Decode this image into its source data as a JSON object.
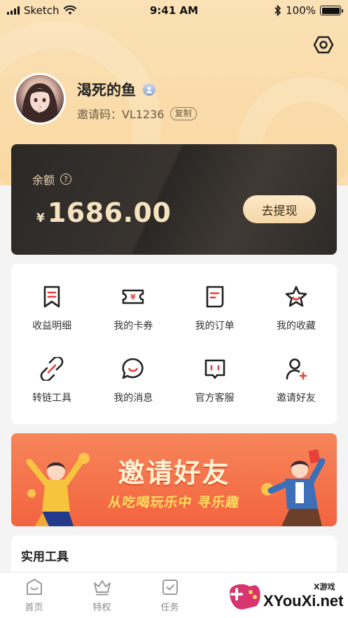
{
  "status_bar": {
    "carrier": "Sketch",
    "time": "9:41 AM",
    "battery": "100%"
  },
  "profile": {
    "username": "渴死的鱼",
    "invite_label": "邀请码：",
    "invite_code": "VL1236",
    "copy_label": "复制"
  },
  "balance": {
    "label": "余额",
    "help_glyph": "?",
    "currency": "¥",
    "amount": "1686.00",
    "withdraw_label": "去提现"
  },
  "menu": {
    "items": [
      {
        "label": "收益明细",
        "icon": "bookmark-list-icon"
      },
      {
        "label": "我的卡券",
        "icon": "ticket-icon"
      },
      {
        "label": "我的订单",
        "icon": "document-icon"
      },
      {
        "label": "我的收藏",
        "icon": "star-icon"
      },
      {
        "label": "转链工具",
        "icon": "link-icon"
      },
      {
        "label": "我的消息",
        "icon": "chat-icon"
      },
      {
        "label": "官方客服",
        "icon": "support-icon"
      },
      {
        "label": "邀请好友",
        "icon": "add-user-icon"
      }
    ]
  },
  "banner": {
    "title": "邀请好友",
    "subtitle": "从吃喝玩乐中 寻乐趣"
  },
  "tools": {
    "title": "实用工具"
  },
  "tabs": [
    {
      "label": "首页",
      "icon": "home-icon"
    },
    {
      "label": "特权",
      "icon": "crown-icon"
    },
    {
      "label": "任务",
      "icon": "task-icon"
    }
  ],
  "watermark": {
    "small": "X游戏",
    "big": "XYouXi.net"
  },
  "colors": {
    "accent_red": "#e8403a",
    "gold": "#f6e2bf",
    "hero_bg": "#fbe1b6"
  }
}
